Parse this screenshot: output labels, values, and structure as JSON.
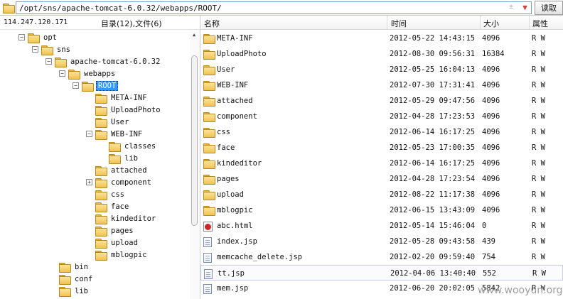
{
  "path_bar": {
    "path": "/opt/sns/apache-tomcat-6.0.32/webapps/ROOT/",
    "star_glyph": "±",
    "dropdown_glyph": "▼",
    "read_button": "读取"
  },
  "left_pane": {
    "server_ip": "114.247.120.171",
    "summary": "目录(12),文件(6)",
    "tree": [
      {
        "label": "opt",
        "toggle": "−"
      },
      {
        "label": "sns",
        "toggle": "−"
      },
      {
        "label": "apache-tomcat-6.0.32",
        "toggle": "−"
      },
      {
        "label": "webapps",
        "toggle": "−"
      },
      {
        "label": "ROOT",
        "toggle": "−",
        "selected": true
      },
      {
        "label": "META-INF",
        "toggle": ""
      },
      {
        "label": "UploadPhoto",
        "toggle": ""
      },
      {
        "label": "User",
        "toggle": ""
      },
      {
        "label": "WEB-INF",
        "toggle": "−"
      },
      {
        "label": "classes",
        "toggle": ""
      },
      {
        "label": "lib",
        "toggle": ""
      },
      {
        "label": "attached",
        "toggle": ""
      },
      {
        "label": "component",
        "toggle": "+"
      },
      {
        "label": "css",
        "toggle": ""
      },
      {
        "label": "face",
        "toggle": ""
      },
      {
        "label": "kindeditor",
        "toggle": ""
      },
      {
        "label": "pages",
        "toggle": ""
      },
      {
        "label": "upload",
        "toggle": ""
      },
      {
        "label": "mblogpic",
        "toggle": ""
      },
      {
        "label": "bin",
        "toggle": ""
      },
      {
        "label": "conf",
        "toggle": ""
      },
      {
        "label": "lib",
        "toggle": ""
      }
    ]
  },
  "file_list": {
    "columns": {
      "name": "名称",
      "time": "时间",
      "size": "大小",
      "attr": "属性"
    },
    "rows": [
      {
        "name": "META-INF",
        "time": "2012-05-22 14:43:15",
        "size": "4096",
        "attr": "R W",
        "icon": "folder-icon"
      },
      {
        "name": "UploadPhoto",
        "time": "2012-08-30 09:56:31",
        "size": "16384",
        "attr": "R W",
        "icon": "folder-icon"
      },
      {
        "name": "User",
        "time": "2012-05-25 16:04:13",
        "size": "4096",
        "attr": "R W",
        "icon": "folder-icon"
      },
      {
        "name": "WEB-INF",
        "time": "2012-07-30 17:31:41",
        "size": "4096",
        "attr": "R W",
        "icon": "folder-icon"
      },
      {
        "name": "attached",
        "time": "2012-05-29 09:47:56",
        "size": "4096",
        "attr": "R W",
        "icon": "folder-icon"
      },
      {
        "name": "component",
        "time": "2012-04-28 17:23:53",
        "size": "4096",
        "attr": "R W",
        "icon": "folder-icon"
      },
      {
        "name": "css",
        "time": "2012-06-14 16:17:25",
        "size": "4096",
        "attr": "R W",
        "icon": "folder-icon"
      },
      {
        "name": "face",
        "time": "2012-05-23 17:00:35",
        "size": "4096",
        "attr": "R W",
        "icon": "folder-icon"
      },
      {
        "name": "kindeditor",
        "time": "2012-06-14 16:17:25",
        "size": "4096",
        "attr": "R W",
        "icon": "folder-icon"
      },
      {
        "name": "pages",
        "time": "2012-04-28 17:23:54",
        "size": "4096",
        "attr": "R W",
        "icon": "folder-icon"
      },
      {
        "name": "upload",
        "time": "2012-08-22 11:17:38",
        "size": "4096",
        "attr": "R W",
        "icon": "folder-icon"
      },
      {
        "name": "mblogpic",
        "time": "2012-06-15 13:43:09",
        "size": "4096",
        "attr": "R W",
        "icon": "folder-icon"
      },
      {
        "name": "abc.html",
        "time": "2012-05-14 15:46:04",
        "size": "0",
        "attr": "R W",
        "icon": "html-file-icon"
      },
      {
        "name": "index.jsp",
        "time": "2012-05-28 09:43:58",
        "size": "439",
        "attr": "R W",
        "icon": "file-icon"
      },
      {
        "name": "memcache_delete.jsp",
        "time": "2012-02-20 09:59:40",
        "size": "754",
        "attr": "R W",
        "icon": "file-icon"
      },
      {
        "name": "tt.jsp",
        "time": "2012-04-06 13:40:40",
        "size": "552",
        "attr": "R W",
        "icon": "file-icon",
        "highlighted": true
      },
      {
        "name": "mem.jsp",
        "time": "2012-06-20 20:02:05",
        "size": "5842",
        "attr": "R W",
        "icon": "file-icon"
      }
    ]
  },
  "watermark": "www.wooyun.org",
  "colors": {
    "folder": "#f0c34f",
    "selection": "#3399ff",
    "border": "#7f9db9"
  }
}
